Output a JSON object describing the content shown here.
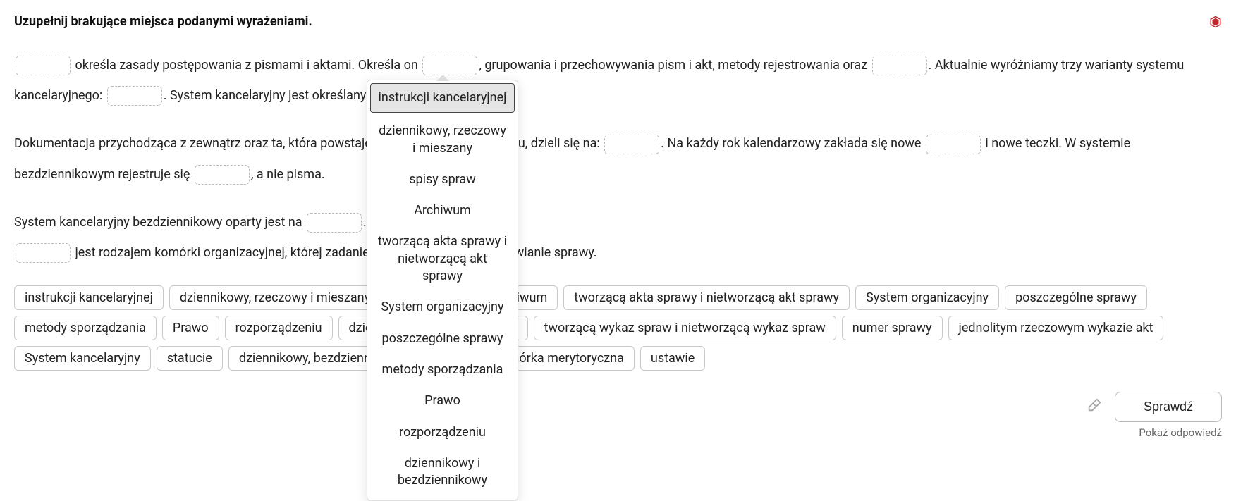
{
  "title": "Uzupełnij brakujące miejsca podanymi wyrażeniami.",
  "paragraph1": {
    "t1": " określa zasady postępowania z pismami i aktami. Określa on ",
    "t2": ", grupowania i przechowywania pism i akt, metody rejestrowania oraz ",
    "t3": ". Aktualnie wyróżniamy trzy warianty systemu kancelaryjnego: ",
    "t4": ". System kancelaryjny jest określany w ",
    "t5": "."
  },
  "paragraph2": {
    "t1": "Dokumentacja przychodząca z zewnątrz oraz ta, która powstaje w toku działalności organu, dzieli się na: ",
    "t2": ". Na każdy rok kalendarzowy zakłada się nowe ",
    "t3": " i nowe teczki. W systemie bezdziennikowym rejestruje się ",
    "t4": ", a nie pisma."
  },
  "paragraph3": {
    "t1": "System kancelaryjny bezdziennikowy oparty jest na ",
    "t2": ".\n",
    "t3": " jest rodzajem komórki organizacyjnej, której zadaniem jest merytoryczne załatwianie sprawy."
  },
  "options": [
    "instrukcji kancelaryjnej",
    "dziennikowy, rzeczowy i mieszany",
    "spisy spraw",
    "Archiwum",
    "tworzącą akta sprawy i nietworzącą akt sprawy",
    "System organizacyjny",
    "poszczególne sprawy",
    "metody sporządzania",
    "Prawo",
    "rozporządzeniu",
    "dziennikowy i bezdziennikowy",
    "tworzącą wykaz spraw i nietworzącą wykaz spraw",
    "numer sprawy",
    "jednolitym rzeczowym wykazie akt",
    "System kancelaryjny",
    "statucie",
    "dziennikowy, bezdziennikowy i mieszany",
    "Komórka merytoryczna",
    "ustawie"
  ],
  "dropdown": [
    "instrukcji kancelaryjnej",
    "dziennikowy, rzeczowy i mieszany",
    "spisy spraw",
    "Archiwum",
    "tworzącą akta sprawy i nietworzącą akt sprawy",
    "System organizacyjny",
    "poszczególne sprawy",
    "metody sporządzania",
    "Prawo",
    "rozporządzeniu",
    "dziennikowy i bezdziennikowy"
  ],
  "dropdown_selected_index": 0,
  "buttons": {
    "check": "Sprawdź",
    "show_answer": "Pokaż odpowiedź"
  }
}
